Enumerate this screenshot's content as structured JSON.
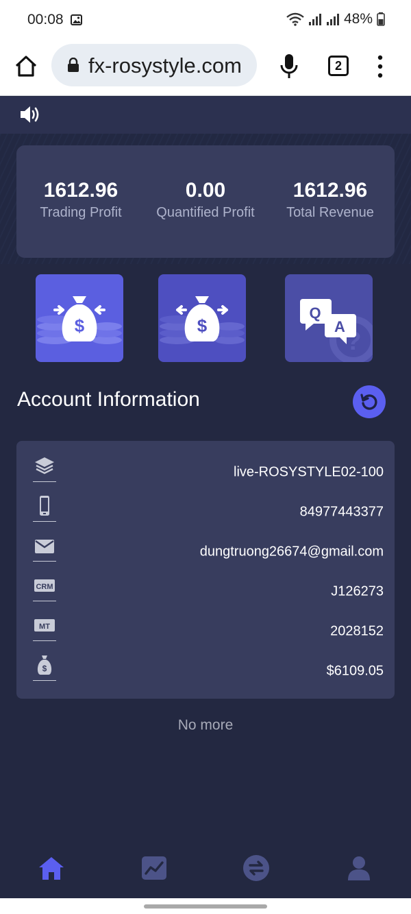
{
  "status_bar": {
    "time": "00:08",
    "battery": "48%"
  },
  "browser": {
    "url": "fx-rosystyle.com",
    "tab_count": "2"
  },
  "stats": [
    {
      "value": "1612.96",
      "label": "Trading Profit"
    },
    {
      "value": "0.00",
      "label": "Quantified Profit"
    },
    {
      "value": "1612.96",
      "label": "Total Revenue"
    }
  ],
  "quick_actions": [
    {
      "icon": "money-bag-deposit-icon"
    },
    {
      "icon": "money-bag-withdraw-icon"
    },
    {
      "icon": "qa-chat-icon"
    }
  ],
  "account": {
    "title": "Account Information",
    "rows": [
      {
        "icon": "layers-icon",
        "value": "live-ROSYSTYLE02-100"
      },
      {
        "icon": "phone-icon",
        "value": "84977443377"
      },
      {
        "icon": "mail-icon",
        "value": "dungtruong26674@gmail.com"
      },
      {
        "icon": "crm-icon",
        "icon_text": "CRM",
        "value": "J126273"
      },
      {
        "icon": "mt-icon",
        "icon_text": "MT",
        "value": "2028152"
      },
      {
        "icon": "money-bag-icon",
        "value": "$6109.05"
      }
    ]
  },
  "list_end": "No more",
  "colors": {
    "accent": "#5b5ff0",
    "background": "#232841",
    "card": "#383d5e"
  }
}
